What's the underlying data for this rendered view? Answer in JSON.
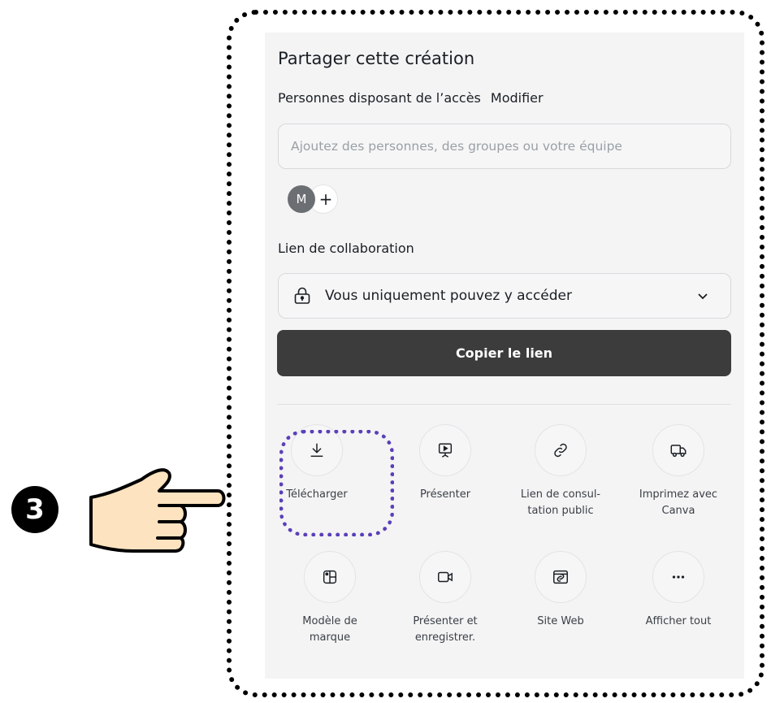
{
  "share": {
    "title": "Partager cette création",
    "access_label": "Personnes disposant de l’accès",
    "modify_link": "Modifier",
    "people_input_placeholder": "Ajoutez des personnes, des groupes ou votre équipe",
    "avatar_initial": "M",
    "add_person": "+"
  },
  "collab": {
    "label": "Lien de collaboration",
    "selected_option": "Vous uniquement pouvez y accéder"
  },
  "copy_button": "Copier le lien",
  "actions": [
    {
      "icon": "download-icon",
      "label": "Télécharger"
    },
    {
      "icon": "present-icon",
      "label": "Présenter"
    },
    {
      "icon": "link-icon",
      "label": "Lien de consul-\ntation public"
    },
    {
      "icon": "truck-icon",
      "label": "Imprimez avec\nCanva"
    },
    {
      "icon": "brand-template-icon",
      "label": "Modèle de\nmarque"
    },
    {
      "icon": "video-camera-icon",
      "label": "Présenter et\nenregistrer."
    },
    {
      "icon": "website-icon",
      "label": "Site Web"
    },
    {
      "icon": "more-icon",
      "label": "Afficher tout"
    }
  ],
  "step_number": "3",
  "colors": {
    "panel_bg": "#f4f4f5",
    "button_dark": "#3c3c3c",
    "highlight_purple": "#5b3fb8",
    "frame_black": "#000000"
  }
}
